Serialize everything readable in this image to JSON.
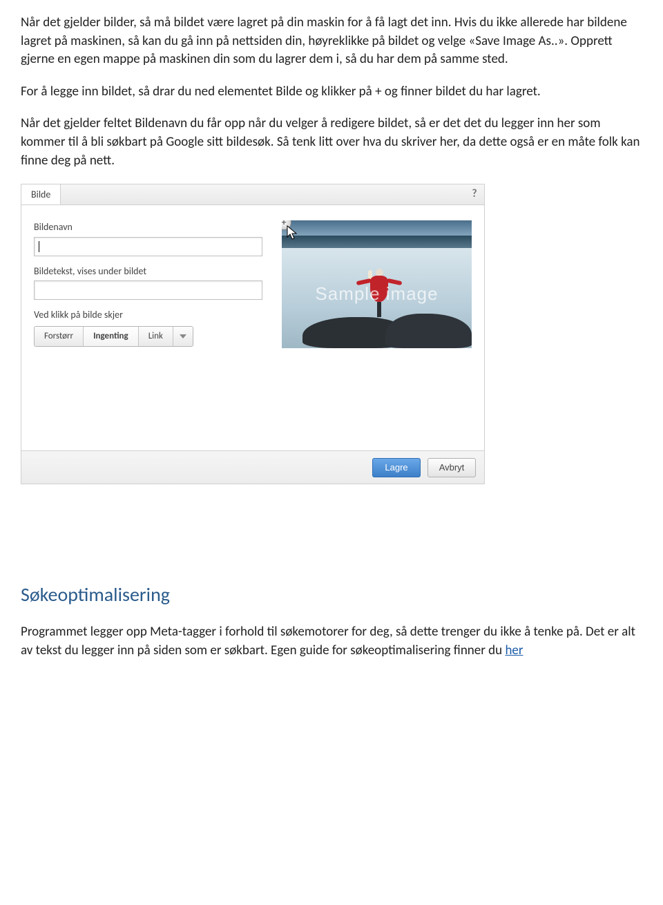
{
  "paragraphs": {
    "p1": "Når det gjelder bilder, så må bildet være lagret på din maskin for å få lagt det inn. Hvis du ikke allerede har bildene lagret på maskinen, så kan du gå inn på nettsiden din, høyreklikke på bildet og velge «Save Image As..». Opprett gjerne en egen mappe på maskinen din som du lagrer dem i, så du har dem på samme sted.",
    "p2": "For å legge inn bildet, så drar du ned elementet Bilde og klikker på + og finner bildet du har lagret.",
    "p3": "Når det gjelder feltet Bildenavn du får opp når du velger å redigere bildet, så er det det du legger inn her som kommer til å bli søkbart på Google sitt bildesøk. Så tenk litt over hva du skriver her, da dette også er en måte folk kan finne deg på nett."
  },
  "panel": {
    "tab": "Bilde",
    "help": "?",
    "label_name": "Bildenavn",
    "value_name": "",
    "label_caption": "Bildetekst, vises under bildet",
    "value_caption": "",
    "label_click": "Ved klikk på bilde skjer",
    "opt_zoom": "Forstørr",
    "opt_nothing": "Ingenting",
    "opt_link": "Link",
    "watermark": "Sample image",
    "save": "Lagre",
    "cancel": "Avbryt"
  },
  "seo": {
    "heading": "Søkeoptimalisering",
    "body_a": "Programmet legger opp Meta-tagger i forhold til søkemotorer for deg, så dette trenger du ikke å tenke på. Det er alt av tekst du legger inn på siden som er søkbart. Egen guide for søkeoptimalisering finner du ",
    "link": "her"
  }
}
